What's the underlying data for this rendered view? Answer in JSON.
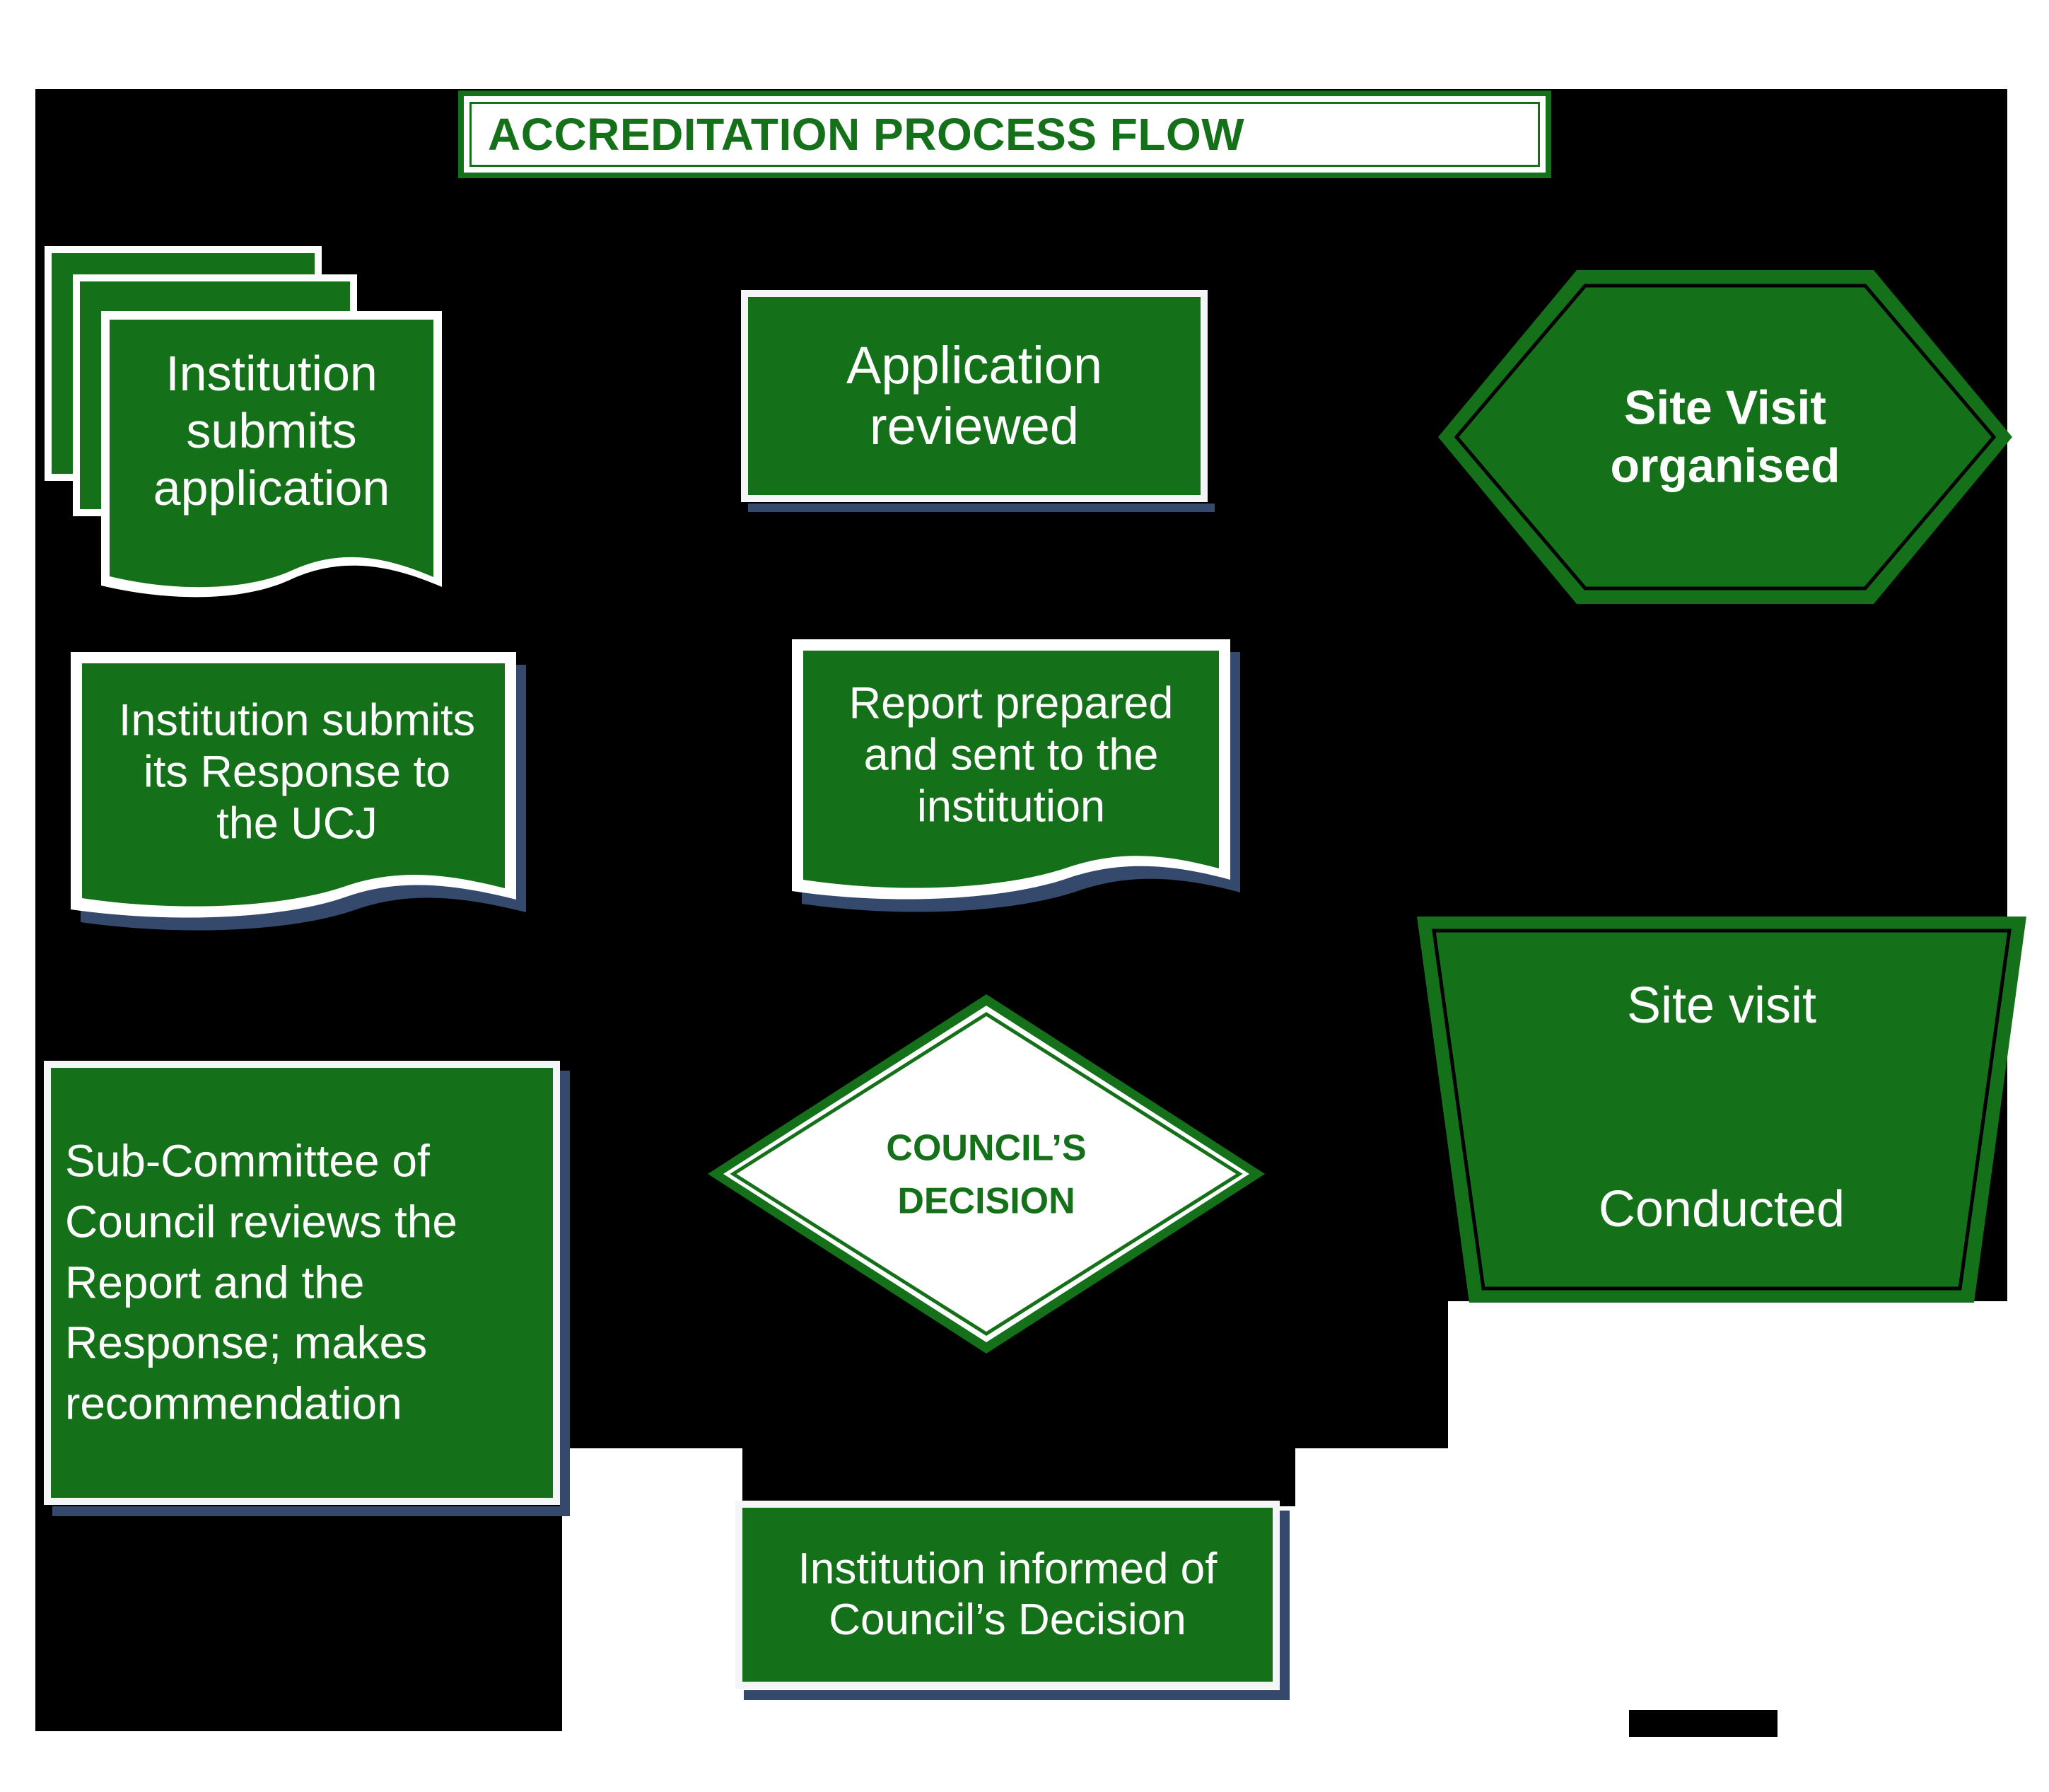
{
  "title": {
    "text": "ACCREDITATION PROCESS FLOW"
  },
  "colors": {
    "green": "#157119",
    "white": "#ffffff",
    "shadow_navy": "#34496b",
    "backdrop": "#000000",
    "outline_black": "#000000"
  },
  "nodes": {
    "submit_application": {
      "label": "Institution\nsubmits\napplication",
      "shape": "multi-document"
    },
    "application_reviewed": {
      "label": "Application\nreviewed",
      "shape": "rectangle"
    },
    "site_visit_organised": {
      "label": "Site Visit\norganised",
      "shape": "hexagon"
    },
    "institution_response": {
      "label": "Institution submits\nits Response to\nthe UCJ",
      "shape": "document"
    },
    "report_prepared": {
      "label": "Report prepared\nand sent to the\ninstitution",
      "shape": "document"
    },
    "site_visit_conducted": {
      "label": "Site visit\n\nConducted",
      "shape": "trapezoid"
    },
    "sub_committee": {
      "label": "Sub-Committee of\nCouncil reviews the\nReport and the\nResponse; makes\nrecommendation",
      "shape": "rectangle"
    },
    "councils_decision": {
      "label": "COUNCIL’S\nDECISION",
      "shape": "diamond"
    },
    "institution_informed": {
      "label": "Institution informed of\nCouncil’s Decision",
      "shape": "rectangle"
    }
  }
}
